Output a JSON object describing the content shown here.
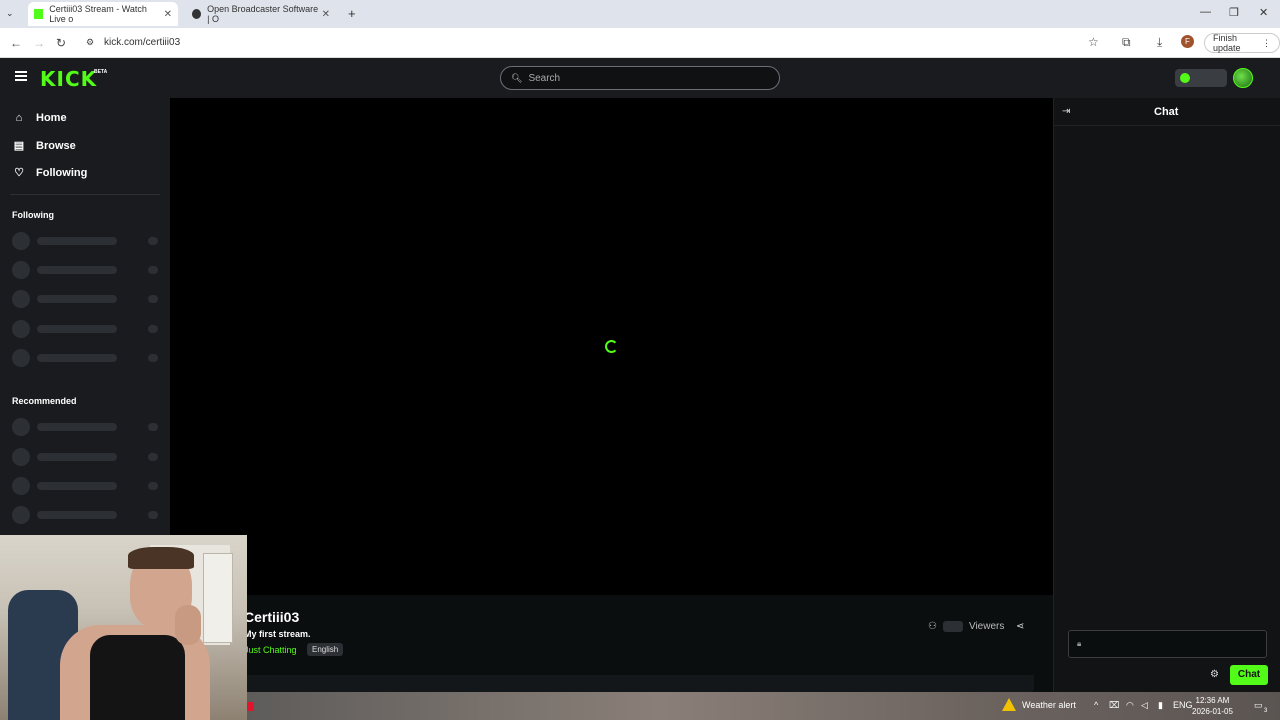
{
  "browser": {
    "tabs": [
      {
        "label": "Certiii03 Stream - Watch Live o",
        "active": true
      },
      {
        "label": "Open Broadcaster Software | O",
        "active": false
      }
    ],
    "url": "kick.com/certiii03",
    "finish_update": "Finish update",
    "profile_initial": "F"
  },
  "header": {
    "logo": "KICK",
    "logo_badge": "BETA",
    "search_placeholder": "Search"
  },
  "sidebar": {
    "nav": [
      {
        "label": "Home",
        "icon": "home-icon"
      },
      {
        "label": "Browse",
        "icon": "browse-icon"
      },
      {
        "label": "Following",
        "icon": "heart-icon"
      }
    ],
    "following_title": "Following",
    "recommended_title": "Recommended"
  },
  "stream": {
    "streamer": "Certiii03",
    "title": "My first stream.",
    "category": "Just Chatting",
    "language": "English",
    "viewers_label": "Viewers"
  },
  "chat": {
    "title": "Chat",
    "send_label": "Chat"
  },
  "taskbar": {
    "weather": "Weather alert",
    "lang": "ENG",
    "time": "12:36 AM",
    "date": "2026-01-05",
    "notif_count": "3"
  },
  "colors": {
    "accent": "#53fc18",
    "background": "#0b0e0f",
    "panel": "#191b1f"
  }
}
